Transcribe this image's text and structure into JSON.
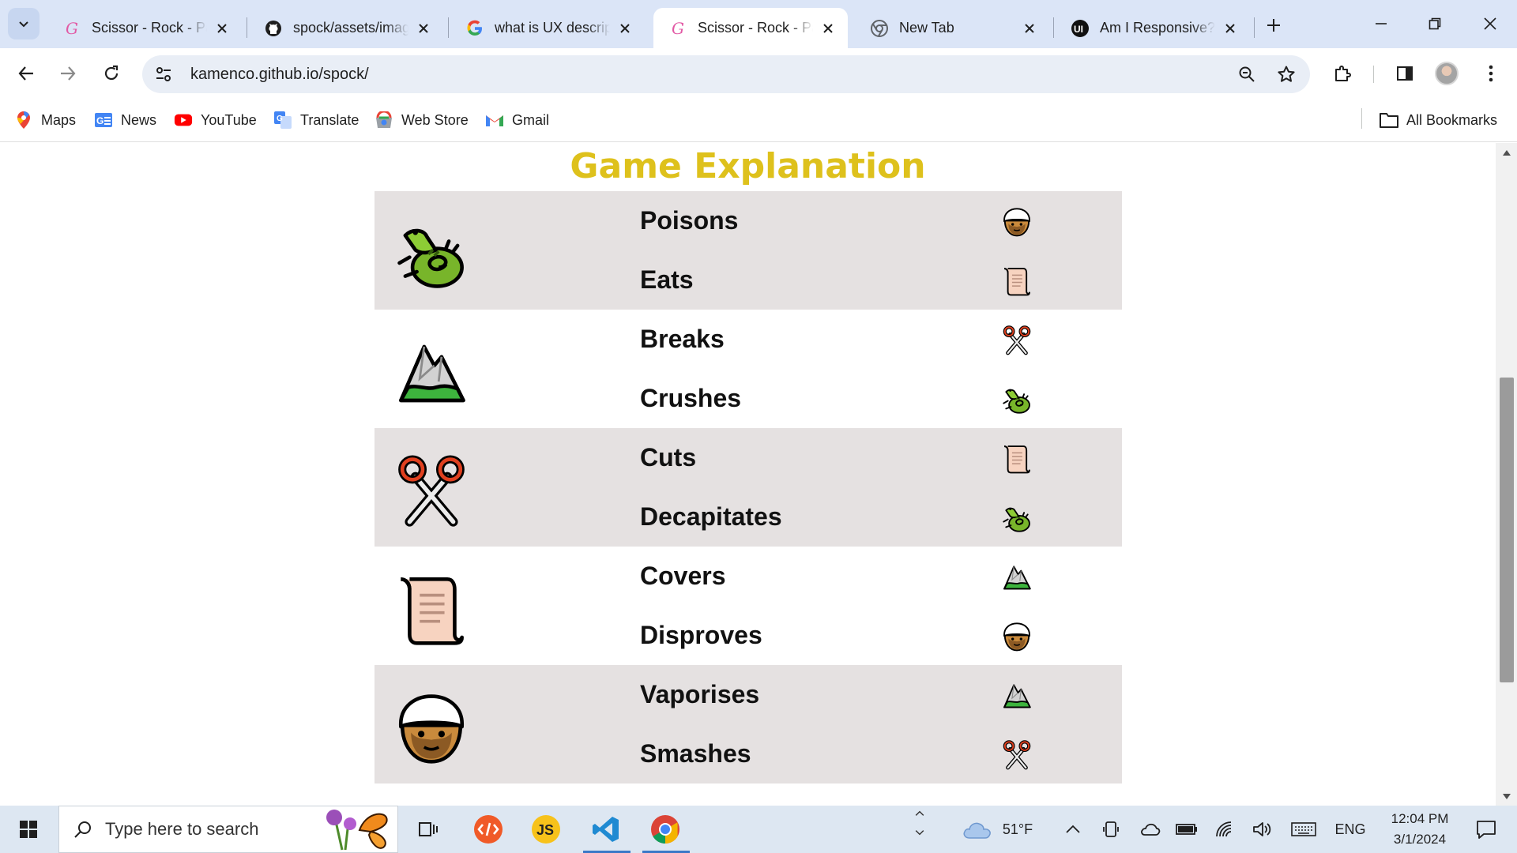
{
  "browser": {
    "tabs": [
      {
        "title": "Scissor - Rock - Paper",
        "favicon": "gradient-g-favicon",
        "active": false
      },
      {
        "title": "spock/assets/images",
        "favicon": "github-icon",
        "active": false
      },
      {
        "title": "what is UX description",
        "favicon": "google-icon",
        "active": false
      },
      {
        "title": "Scissor - Rock - Paper",
        "favicon": "gradient-g-favicon",
        "active": true
      },
      {
        "title": "New Tab",
        "favicon": "chrome-icon",
        "active": false
      },
      {
        "title": "Am I Responsive?",
        "favicon": "ui-icon",
        "active": false
      }
    ],
    "url": "kamenco.github.io/spock/",
    "bookmarks": [
      {
        "label": "Maps",
        "icon": "maps-pin-icon"
      },
      {
        "label": "News",
        "icon": "news-icon"
      },
      {
        "label": "YouTube",
        "icon": "youtube-icon"
      },
      {
        "label": "Translate",
        "icon": "translate-icon"
      },
      {
        "label": "Web Store",
        "icon": "webstore-icon"
      },
      {
        "label": "Gmail",
        "icon": "gmail-icon"
      }
    ],
    "all_bookmarks": "All Bookmarks"
  },
  "page": {
    "title": "Game Explanation",
    "title_color": "#dec11c",
    "rows": [
      {
        "player": "lizard",
        "actions": [
          {
            "verb": "Poisons",
            "target": "spock"
          },
          {
            "verb": "Eats",
            "target": "paper"
          }
        ],
        "shaded": true
      },
      {
        "player": "rock",
        "actions": [
          {
            "verb": "Breaks",
            "target": "scissors"
          },
          {
            "verb": "Crushes",
            "target": "lizard"
          }
        ],
        "shaded": false
      },
      {
        "player": "scissors",
        "actions": [
          {
            "verb": "Cuts",
            "target": "paper"
          },
          {
            "verb": "Decapitates",
            "target": "lizard"
          }
        ],
        "shaded": true
      },
      {
        "player": "paper",
        "actions": [
          {
            "verb": "Covers",
            "target": "rock"
          },
          {
            "verb": "Disproves",
            "target": "spock"
          }
        ],
        "shaded": false
      },
      {
        "player": "spock",
        "actions": [
          {
            "verb": "Vaporises",
            "target": "rock"
          },
          {
            "verb": "Smashes",
            "target": "scissors"
          }
        ],
        "shaded": true
      }
    ]
  },
  "taskbar": {
    "search_placeholder": "Type here to search",
    "weather": "51°F",
    "language": "ENG",
    "time": "12:04 PM",
    "date": "3/1/2024",
    "apps": [
      "task-view-icon",
      "code-editor-icon",
      "js-icon",
      "vscode-icon",
      "chrome-icon"
    ]
  }
}
